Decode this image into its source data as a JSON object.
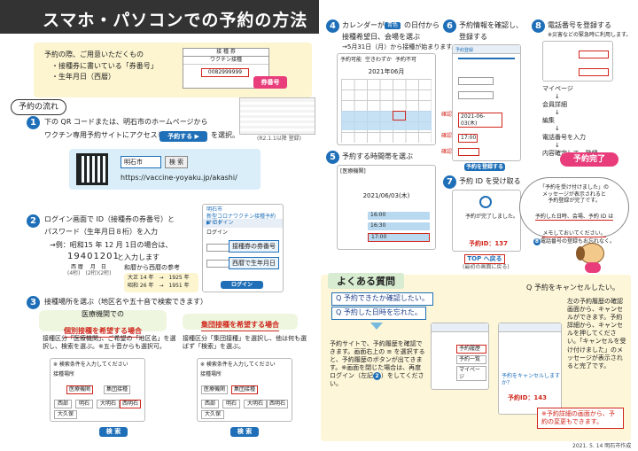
{
  "title": "スマホ・パソコンでの予約の方法",
  "prep": {
    "lead": "予約の際、ご用意いただくもの",
    "items": [
      "・接種券に書いている「券番号」",
      "・生年月日（西暦）"
    ],
    "ticket_head": "接 種 券",
    "ticket_row1": "ワクチン接種",
    "ticket_no": "0082999999",
    "ticket_badge": "券番号",
    "sample_caption": "(R2.1.1以降 登録)"
  },
  "flow_label": "予約の流れ",
  "steps": {
    "s1": {
      "num": "1",
      "text1": "下の QR コードまたは、明石市のホームページから",
      "text2": "ワクチン専用予約サイトにアクセスして",
      "button": "予約する",
      "text3": "を選択。",
      "search_value": "明石市",
      "search_button": "検 索",
      "url": "https://vaccine-yoyaku.jp/akashi/"
    },
    "s2": {
      "num": "2",
      "text1": "ログイン画面で ID（接種券の券番号）と",
      "text2": "パスワード（生年月日８桁）を入力",
      "example1": "→例：昭和15 年 12 月 1日の場合は、",
      "example_num": "19401201",
      "example2": "と入力します",
      "example_labels": "西 暦　 月　日",
      "example_sub": "(4桁)　(2桁)(2桁)",
      "era_title": "和暦から西暦の参考",
      "era1": "大正 14 年　→　1925 年",
      "era2": "昭和 26 年　→　1951 年",
      "phone_title": "明石市\n新型コロナワクチン接種予約サイト",
      "login_head": "▶ ログイン",
      "login_label": "ログイン",
      "id_tag": "接種券の券番号",
      "pw_tag": "西暦で生年月日",
      "login_button": "ログイン"
    },
    "s3": {
      "num": "3",
      "text": "接種場所を選ぶ（地区名や五十音で検索できます）",
      "left_head1": "医療機関での",
      "left_head2": "個別接種を希望する場合",
      "left_body": "接種区分「医療機関」、ご希望の「地区名」を選択し、検索を選ぶ。※五十音からも選択可。",
      "right_head": "集団接種を希望する場合",
      "right_body": "接種区分「集団接種」を選択し、他は何も選ばず「検索」を選ぶ。",
      "left_options": [
        "医療機関",
        "集団接種"
      ],
      "left_areas": [
        "西部",
        "明石",
        "大明石",
        "西明石",
        "大久保"
      ],
      "right_options": [
        "医療機関",
        "集団接種"
      ],
      "right_areas": [
        "西部",
        "明石",
        "大明石",
        "西明石",
        "大久保"
      ],
      "search_button": "検 索",
      "search_label": "接種場所",
      "search_note": "※ 検索条件を入力してください"
    },
    "s4": {
      "num": "4",
      "text1": "カレンダーが",
      "badge": "青色",
      "text2": "の日付から",
      "text3": "接種希望日、会場を選ぶ",
      "note": "→5月31日（月）から接種が始まります。",
      "month": "2021年06月",
      "legend": [
        "予約可能",
        "空きわずか",
        "予約不可"
      ]
    },
    "s5": {
      "num": "5",
      "text": "予約する時間帯を選ぶ",
      "panel_head": "[医療機関]",
      "date": "2021/06/03(木)",
      "slots": [
        "16:00",
        "16:30",
        "17:00"
      ]
    },
    "s6": {
      "num": "6",
      "text1": "予約情報を確認し、",
      "text2": "登録する",
      "confirm_tag": "確認",
      "panel_title": "予約登録",
      "date_value": "2021-06-03(木)",
      "time_value": "17:00",
      "button": "予約を登録する"
    },
    "s7": {
      "num": "7",
      "text": "予約 ID を受け取る",
      "id_label": "予約ID：137",
      "top_button": "TOP へ戻る",
      "top_note": "(最初の画面に戻る)",
      "body": "予約が完了しました。"
    },
    "s8": {
      "num": "8",
      "text": "電話番号を登録する",
      "note": "※災害などの緊急時に利用します。",
      "menu": [
        "マイページ",
        "↓",
        "会員詳細",
        "↓",
        "編集",
        "↓",
        "電話番号を入力",
        "↓",
        "内容確定して、登録"
      ],
      "done": "予約完了"
    }
  },
  "bubble": {
    "l1": "「予約を受け付けました」の",
    "l2": "メッセージが表示されると",
    "l3": "予約登録が完了です。",
    "l4": "予約した日時、会場、予約 ID は",
    "l5": "メモしておいてください。",
    "l6_num": "8",
    "l6": "電話番号の登録もお忘れなく。"
  },
  "faq": {
    "title": "よくある質問",
    "q1a": "Q 予約できたか確認したい。",
    "q1b": "Q 予約した日時を忘れた。",
    "a1": "予約サイトで、予約履歴を確認できます。画面右上の ≡ を選択すると、予約履歴のボタンが出てきます。※画面を閉じた場合は、再度ログイン（左記",
    "a1_num": "2",
    "a1_end": "）をしてください。",
    "q2": "Q 予約をキャンセルしたい。",
    "a2": "左の予約履歴の確認画面から、キャンセルができます。予約詳細から、キャンセルを押してください。「キャンセルを受け付けました」のメッセージが表示されると完了です。",
    "menu_items": [
      "予約履歴",
      "予約一覧",
      "マイページ"
    ],
    "cancel_q": "予約をキャンセルしますか？",
    "cancel_id": "予約ID：143",
    "note": "※予約詳細の画面から、予約の変更もできます。"
  },
  "footer": "2021. 5. 14 明石市作成"
}
